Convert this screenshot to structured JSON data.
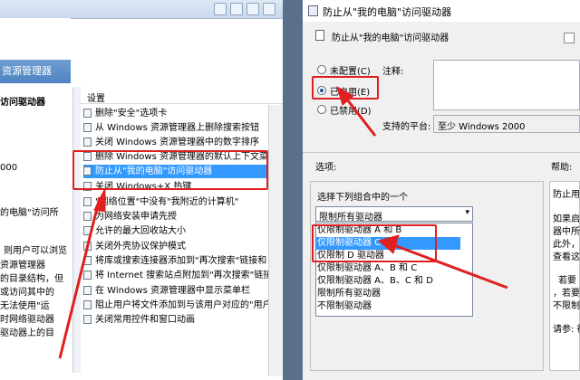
{
  "left_window": {
    "heading_fragment": "资源管理器",
    "subheading_fragment": "访问驱动器",
    "year_fragment": "000",
    "left_text": [
      "的电脑\"访问所",
      "则用户可以浏览",
      "资源管理器",
      "的目录结构，但",
      "或访问其中的",
      "无法使用\"运",
      "时网络驱动器",
      "驱动器上的目"
    ],
    "settings_header": "设置",
    "policies": [
      "删除\"安全\"选项卡",
      "从 Windows 资源管理器上删除搜索按钮",
      "关闭 Windows 资源管理器中的数字排序",
      "删除 Windows 资源管理器的默认上下文菜单",
      "防止从\"我的电脑\"访问驱动器",
      "关闭 Windows+X 热键",
      "\"网络位置\"中没有\"我附近的计算机\"",
      "为网络安装申请先授",
      "允许的最大回收站大小",
      "关闭外壳协议保护模式",
      "将库或搜索连接器添加到\"再次搜索\"链接和",
      "将 Internet 搜索站点附加到\"再次搜索\"链接",
      "在 Windows 资源管理器中显示菜单栏",
      "阻止用户将文件添加到与该用户对应的\"用户\"",
      "关闭常用控件和窗口动画"
    ],
    "selected_policy_index": 4
  },
  "right_window": {
    "title": "防止从\"我的电脑\"访问驱动器",
    "subtitle": "防止从\"我的电脑\"访问驱动器",
    "radio_options": [
      "未配置(C)",
      "已启用(E)",
      "已禁用(D)"
    ],
    "selected_radio_index": 1,
    "comment_label": "注释:",
    "platform_label": "支持的平台:",
    "platform_value": "至少 Windows 2000",
    "options_label": "选项:",
    "help_label": "帮助:",
    "choose_label": "选择下列组合中的一个",
    "dropdown_value": "限制所有驱动器",
    "list_options": [
      "仅限制驱动器 A 和 B",
      "仅限制驱动器 C",
      "仅限制 D 驱动器",
      "仅限制驱动器 A、B 和 C",
      "仅限制驱动器 A、B、C 和 D",
      "限制所有驱动器",
      "不限制驱动器"
    ],
    "selected_list_index": 1,
    "help_text": [
      "防止用",
      "如果启",
      "器中所",
      "此外，",
      "查看这",
      "若要",
      "，若要",
      "不限制",
      "请参: 行"
    ]
  },
  "colors": {
    "highlight": "#3399ff",
    "annotation_red": "#e02020"
  }
}
